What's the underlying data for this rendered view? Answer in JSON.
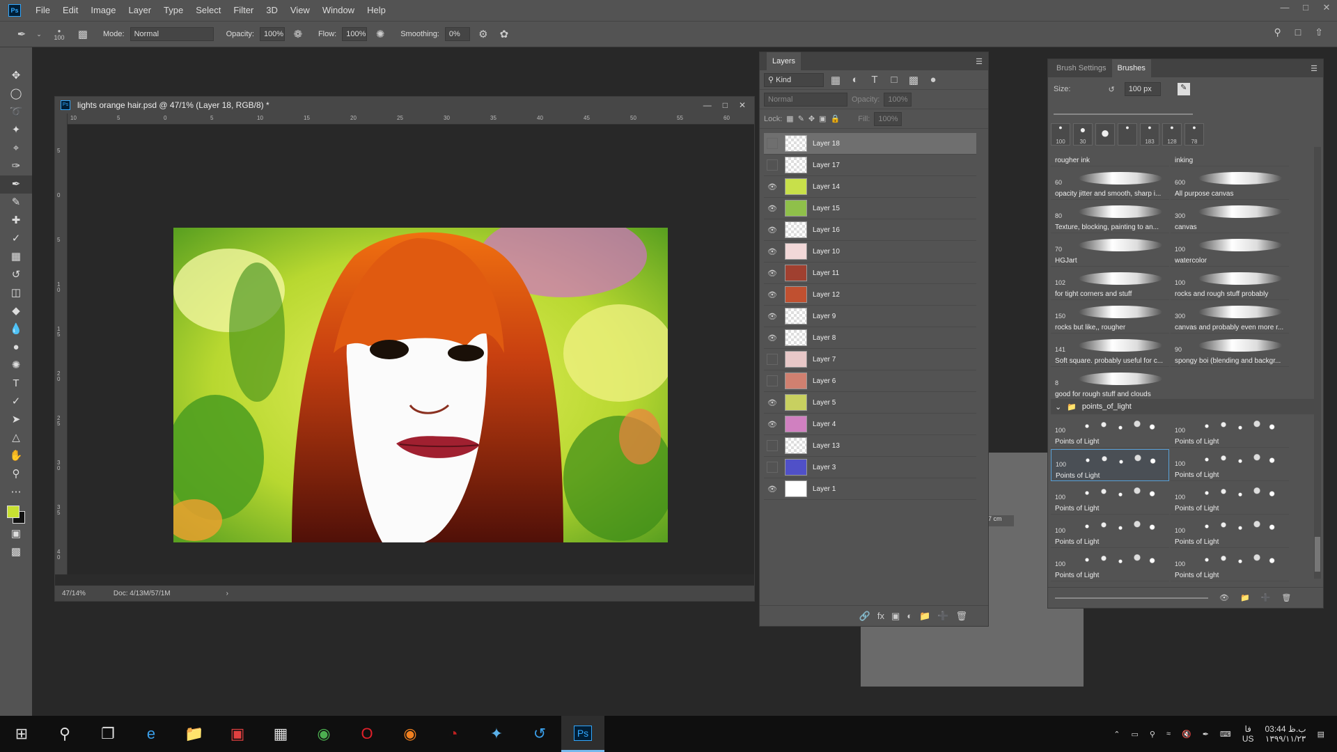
{
  "menu": [
    "File",
    "Edit",
    "Image",
    "Layer",
    "Type",
    "Select",
    "Filter",
    "3D",
    "View",
    "Window",
    "Help"
  ],
  "app_logo": "Ps",
  "options": {
    "brush_size": "100",
    "mode_label": "Mode:",
    "mode_value": "Normal",
    "opacity_label": "Opacity:",
    "opacity_value": "100%",
    "flow_label": "Flow:",
    "flow_value": "100%",
    "smoothing_label": "Smoothing:",
    "smoothing_value": "0%"
  },
  "document": {
    "title": "lights orange hair.psd @ 47/1% (Layer 18, RGB/8) *",
    "zoom": "47/14%",
    "doc_info": "Doc: 4/13M/57/1M",
    "ruler_h": [
      "10",
      "5",
      "0",
      "5",
      "10",
      "15",
      "20",
      "25",
      "30",
      "35",
      "40",
      "45",
      "50",
      "55",
      "60"
    ],
    "ruler_v": [
      "5",
      "0",
      "5",
      "10",
      "15",
      "20",
      "25",
      "30",
      "35",
      "40"
    ]
  },
  "layers_panel": {
    "tab": "Layers",
    "filter_kind": "Kind",
    "blend_mode": "Normal",
    "opacity_label": "Opacity:",
    "opacity_value": "100%",
    "lock_label": "Lock:",
    "fill_label": "Fill:",
    "fill_value": "100%",
    "layers": [
      {
        "name": "Layer 18",
        "visible": false,
        "selected": true
      },
      {
        "name": "Layer 17",
        "visible": false
      },
      {
        "name": "Layer 14",
        "visible": true
      },
      {
        "name": "Layer 15",
        "visible": true
      },
      {
        "name": "Layer 16",
        "visible": true
      },
      {
        "name": "Layer 10",
        "visible": true
      },
      {
        "name": "Layer 11",
        "visible": true
      },
      {
        "name": "Layer 12",
        "visible": true
      },
      {
        "name": "Layer 9",
        "visible": true
      },
      {
        "name": "Layer 8",
        "visible": true
      },
      {
        "name": "Layer 7",
        "visible": false
      },
      {
        "name": "Layer 6",
        "visible": false
      },
      {
        "name": "Layer 5",
        "visible": true
      },
      {
        "name": "Layer 4",
        "visible": true
      },
      {
        "name": "Layer 13",
        "visible": false
      },
      {
        "name": "Layer 3",
        "visible": false
      },
      {
        "name": "Layer 1",
        "visible": true
      }
    ],
    "thumb_colors": [
      "#eee",
      "#eee",
      "#c8e04a",
      "#8fc04a",
      "#eee",
      "#f2d8d8",
      "#a04030",
      "#c05030",
      "#eee",
      "#eee",
      "#e8c8c8",
      "#d08070",
      "#c8d060",
      "#d080c0",
      "#eee",
      "#5050c8",
      "#ffffff"
    ]
  },
  "brushes_panel": {
    "tab_settings": "Brush Settings",
    "tab_brushes": "Brushes",
    "size_label": "Size:",
    "size_value": "100 px",
    "recent_sizes": [
      "100",
      "30",
      "",
      "",
      "183",
      "128",
      "78"
    ],
    "brushes": [
      {
        "num": "",
        "name": "rougher ink"
      },
      {
        "num": "",
        "name": "inking"
      },
      {
        "num": "60",
        "name": "opacity jitter and smooth, sharp i..."
      },
      {
        "num": "600",
        "name": "All purpose canvas"
      },
      {
        "num": "80",
        "name": "Texture, blocking, painting to an..."
      },
      {
        "num": "300",
        "name": "canvas"
      },
      {
        "num": "70",
        "name": "HGJart"
      },
      {
        "num": "100",
        "name": "watercolor"
      },
      {
        "num": "102",
        "name": "for tight corners and stuff"
      },
      {
        "num": "100",
        "name": "rocks and rough stuff probably"
      },
      {
        "num": "150",
        "name": "rocks but like,, rougher"
      },
      {
        "num": "300",
        "name": "canvas and probably even more r..."
      },
      {
        "num": "141",
        "name": "Soft square. probably useful for c..."
      },
      {
        "num": "90",
        "name": "spongy boi (blending and backgr..."
      },
      {
        "num": "8",
        "name": "good for rough stuff and clouds"
      }
    ],
    "group_name": "points_of_light",
    "points": [
      {
        "num": "100",
        "name": "Points of Light"
      },
      {
        "num": "100",
        "name": "Points of Light"
      },
      {
        "num": "100",
        "name": "Points of Light",
        "selected": true
      },
      {
        "num": "100",
        "name": "Points of Light"
      },
      {
        "num": "100",
        "name": "Points of Light"
      },
      {
        "num": "100",
        "name": "Points of Light"
      },
      {
        "num": "100",
        "name": "Points of Light"
      },
      {
        "num": "100",
        "name": "Points of Light"
      },
      {
        "num": "100",
        "name": "Points of Light"
      },
      {
        "num": "100",
        "name": "Points of Light"
      }
    ]
  },
  "ghost_field": "7 cm",
  "tray": {
    "lang1": "فا",
    "lang2": "US",
    "time": "03:44 ب.ظ",
    "date": "۱۳۹۹/۱۱/۲۳"
  }
}
